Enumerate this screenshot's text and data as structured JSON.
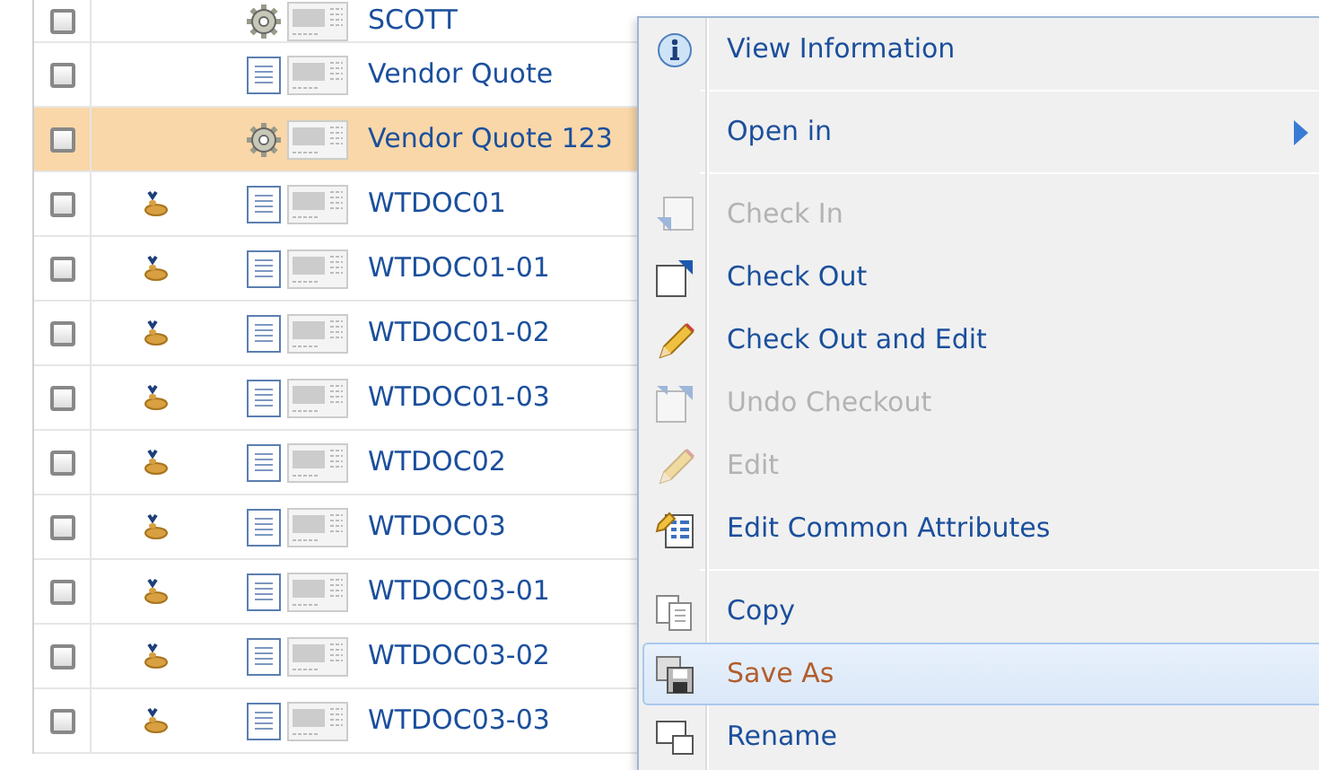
{
  "table": {
    "rows": [
      {
        "name": "SCOTT",
        "kind": "gear",
        "status": false,
        "checked": false,
        "selected": false
      },
      {
        "name": "Vendor Quote",
        "kind": "document",
        "status": false,
        "checked": false,
        "selected": false
      },
      {
        "name": "Vendor Quote 123",
        "kind": "gear",
        "status": false,
        "checked": false,
        "selected": true
      },
      {
        "name": "WTDOC01",
        "kind": "document",
        "status": true,
        "checked": false,
        "selected": false
      },
      {
        "name": "WTDOC01-01",
        "kind": "document",
        "status": true,
        "checked": false,
        "selected": false
      },
      {
        "name": "WTDOC01-02",
        "kind": "document",
        "status": true,
        "checked": false,
        "selected": false
      },
      {
        "name": "WTDOC01-03",
        "kind": "document",
        "status": true,
        "checked": false,
        "selected": false
      },
      {
        "name": "WTDOC02",
        "kind": "document",
        "status": true,
        "checked": false,
        "selected": false
      },
      {
        "name": "WTDOC03",
        "kind": "document",
        "status": true,
        "checked": false,
        "selected": false
      },
      {
        "name": "WTDOC03-01",
        "kind": "document",
        "status": true,
        "checked": false,
        "selected": false
      },
      {
        "name": "WTDOC03-02",
        "kind": "document",
        "status": true,
        "checked": false,
        "selected": false
      },
      {
        "name": "WTDOC03-03",
        "kind": "document",
        "status": true,
        "checked": false,
        "selected": false
      }
    ]
  },
  "context_menu": {
    "items": [
      {
        "label": "View Information",
        "kind": "info",
        "disabled": false,
        "hovered": false,
        "submenu": false
      },
      {
        "kind": "separator"
      },
      {
        "label": "Open in",
        "kind": "plain",
        "disabled": false,
        "hovered": false,
        "submenu": true
      },
      {
        "kind": "separator"
      },
      {
        "label": "Check In",
        "kind": "checkin",
        "disabled": true,
        "hovered": false,
        "submenu": false
      },
      {
        "label": "Check Out",
        "kind": "checkout",
        "disabled": false,
        "hovered": false,
        "submenu": false
      },
      {
        "label": "Check Out and Edit",
        "kind": "pencil",
        "disabled": false,
        "hovered": false,
        "submenu": false
      },
      {
        "label": "Undo Checkout",
        "kind": "undo",
        "disabled": true,
        "hovered": false,
        "submenu": false
      },
      {
        "label": "Edit",
        "kind": "pencil",
        "disabled": true,
        "hovered": false,
        "submenu": false
      },
      {
        "label": "Edit Common Attributes",
        "kind": "attributes",
        "disabled": false,
        "hovered": false,
        "submenu": false
      },
      {
        "kind": "separator"
      },
      {
        "label": "Copy",
        "kind": "copy",
        "disabled": false,
        "hovered": false,
        "submenu": false
      },
      {
        "label": "Save As",
        "kind": "save",
        "disabled": false,
        "hovered": true,
        "submenu": false
      },
      {
        "label": "Rename",
        "kind": "rename",
        "disabled": false,
        "hovered": false,
        "submenu": false
      }
    ]
  }
}
